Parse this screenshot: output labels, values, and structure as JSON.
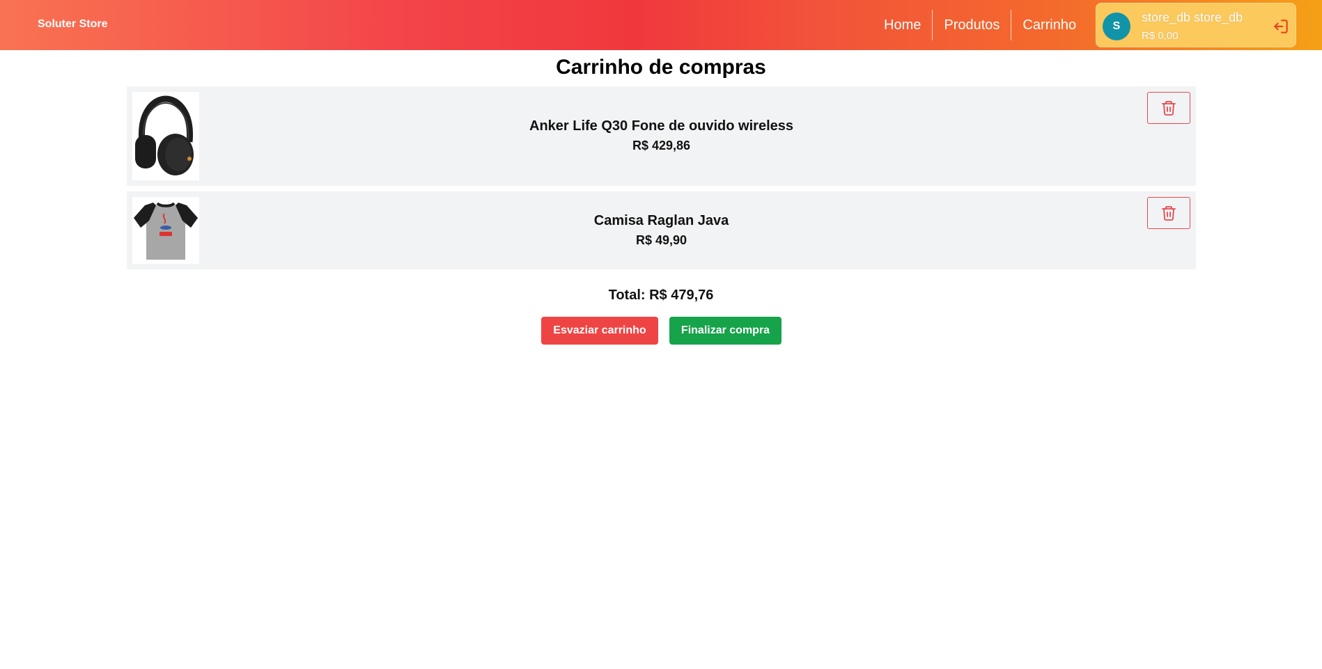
{
  "navbar": {
    "brand": "Soluter Store",
    "links": [
      "Home",
      "Produtos",
      "Carrinho"
    ],
    "user": {
      "initial": "S",
      "name": "store_db store_db",
      "balance": "R$ 0,00",
      "logout_icon": "logout-icon"
    }
  },
  "cart": {
    "title": "Carrinho de compras",
    "items": [
      {
        "name": "Anker Life Q30 Fone de ouvido wireless",
        "price": "R$ 429,86",
        "image_icon": "headphones-image"
      },
      {
        "name": "Camisa Raglan Java",
        "price": "R$ 49,90",
        "image_icon": "tshirt-image"
      }
    ],
    "delete_icon": "trash-icon",
    "total": "Total: R$ 479,76",
    "empty_label": "Esvaziar carrinho",
    "finish_label": "Finalizar compra"
  },
  "colors": {
    "accent_red": "#ef4444",
    "accent_green": "#16a34a",
    "avatar": "#1194a8",
    "user_box": "#fbc95c"
  }
}
